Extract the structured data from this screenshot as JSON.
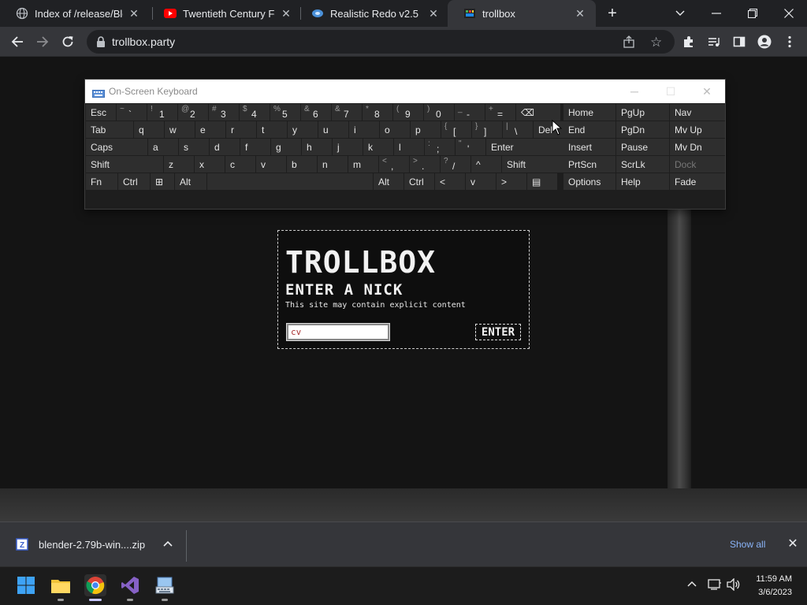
{
  "browser": {
    "tabs": [
      {
        "title": "Index of /release/Blend",
        "favicon": "globe-icon",
        "active": false
      },
      {
        "title": "Twentieth Century Fox",
        "favicon": "youtube-icon",
        "active": false
      },
      {
        "title": "Realistic Redo v2.5",
        "favicon": "app-icon",
        "active": false
      },
      {
        "title": "trollbox",
        "favicon": "trollbox-icon",
        "active": true
      }
    ],
    "url": "trollbox.party"
  },
  "osk": {
    "title": "On-Screen Keyboard",
    "rows": [
      [
        {
          "label": "Esc"
        },
        {
          "shift": "~",
          "main": "`"
        },
        {
          "shift": "!",
          "main": "1"
        },
        {
          "shift": "@",
          "main": "2"
        },
        {
          "shift": "#",
          "main": "3"
        },
        {
          "shift": "$",
          "main": "4"
        },
        {
          "shift": "%",
          "main": "5"
        },
        {
          "shift": "&",
          "main": "6"
        },
        {
          "shift": "&",
          "main": "7"
        },
        {
          "shift": "*",
          "main": "8"
        },
        {
          "shift": "(",
          "main": "9"
        },
        {
          "shift": ")",
          "main": "0"
        },
        {
          "shift": "_",
          "main": "-"
        },
        {
          "shift": "+",
          "main": "="
        },
        {
          "label": "⌫"
        }
      ],
      [
        {
          "label": "Tab"
        },
        {
          "label": "q"
        },
        {
          "label": "w"
        },
        {
          "label": "e"
        },
        {
          "label": "r"
        },
        {
          "label": "t"
        },
        {
          "label": "y"
        },
        {
          "label": "u"
        },
        {
          "label": "i"
        },
        {
          "label": "o"
        },
        {
          "label": "p"
        },
        {
          "shift": "{",
          "main": "["
        },
        {
          "shift": "}",
          "main": "]"
        },
        {
          "shift": "|",
          "main": "\\"
        },
        {
          "label": "Del"
        }
      ],
      [
        {
          "label": "Caps"
        },
        {
          "label": "a"
        },
        {
          "label": "s"
        },
        {
          "label": "d"
        },
        {
          "label": "f"
        },
        {
          "label": "g"
        },
        {
          "label": "h"
        },
        {
          "label": "j"
        },
        {
          "label": "k"
        },
        {
          "label": "l"
        },
        {
          "shift": ":",
          "main": ";"
        },
        {
          "shift": "\"",
          "main": "'"
        },
        {
          "label": "Enter"
        }
      ],
      [
        {
          "label": "Shift"
        },
        {
          "label": "z"
        },
        {
          "label": "x"
        },
        {
          "label": "c"
        },
        {
          "label": "v"
        },
        {
          "label": "b"
        },
        {
          "label": "n"
        },
        {
          "label": "m"
        },
        {
          "shift": "<",
          "main": ","
        },
        {
          "shift": ">",
          "main": "."
        },
        {
          "shift": "?",
          "main": "/"
        },
        {
          "label": "^"
        },
        {
          "label": "Shift"
        }
      ],
      [
        {
          "label": "Fn"
        },
        {
          "label": "Ctrl"
        },
        {
          "label": "⊞"
        },
        {
          "label": "Alt"
        },
        {
          "label": ""
        },
        {
          "label": "Alt"
        },
        {
          "label": "Ctrl"
        },
        {
          "label": "<"
        },
        {
          "label": "v"
        },
        {
          "label": ">"
        },
        {
          "label": "▤"
        }
      ]
    ],
    "nav_rows": [
      [
        "Home",
        "PgUp",
        "Nav"
      ],
      [
        "End",
        "PgDn",
        "Mv Up"
      ],
      [
        "Insert",
        "Pause",
        "Mv Dn"
      ],
      [
        "PrtScn",
        "ScrLk",
        "Dock"
      ],
      [
        "Options",
        "Help",
        "Fade"
      ]
    ]
  },
  "trollbox": {
    "title": "TROLLBOX",
    "enter_nick": "ENTER A NICK",
    "warning": "This site may contain explicit content",
    "nick_value": "cv",
    "enter_button": "ENTER"
  },
  "download": {
    "filename": "blender-2.79b-win....zip",
    "show_all": "Show all"
  },
  "taskbar": {
    "time": "11:59 AM",
    "date": "3/6/2023"
  }
}
